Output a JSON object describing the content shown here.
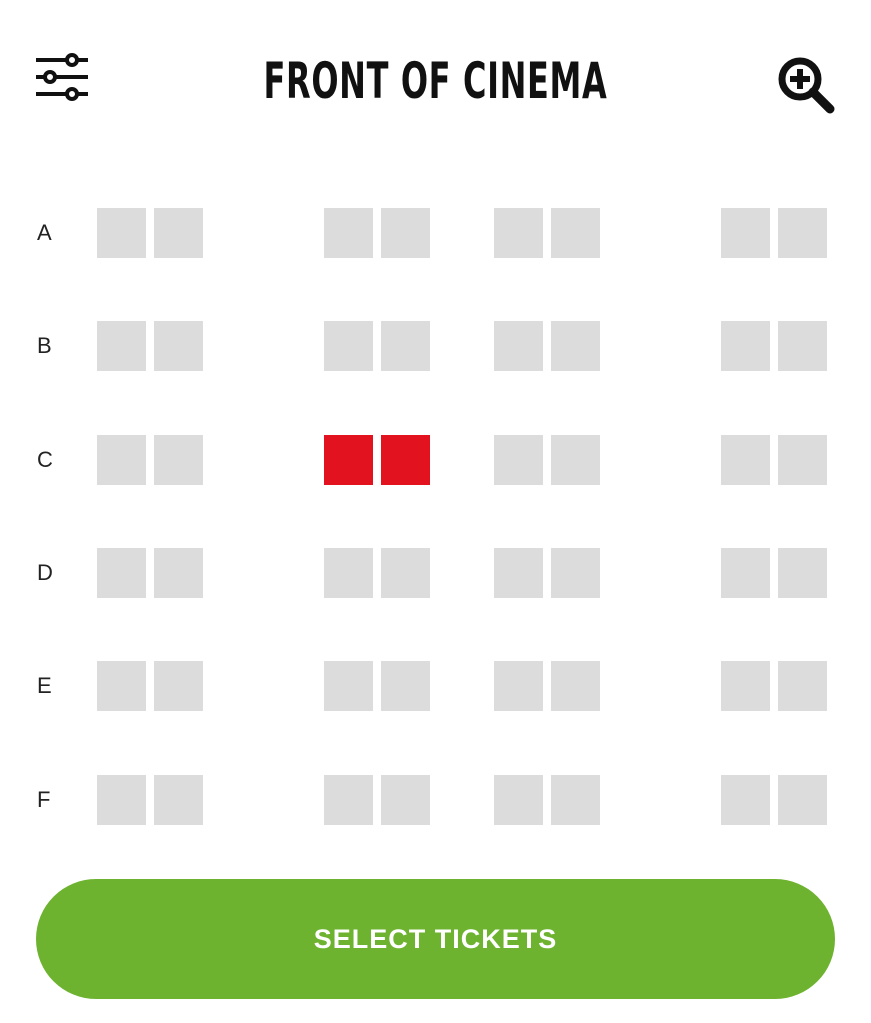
{
  "header": {
    "title": "FRONT OF CINEMA",
    "left_icon": "filter-sliders-icon",
    "right_icon": "zoom-in-icon"
  },
  "seat_map": {
    "rows": [
      {
        "label": "A",
        "seats": [
          "available",
          "available",
          "available",
          "available",
          "available",
          "available",
          "available",
          "available"
        ]
      },
      {
        "label": "B",
        "seats": [
          "available",
          "available",
          "available",
          "available",
          "available",
          "available",
          "available",
          "available"
        ]
      },
      {
        "label": "C",
        "seats": [
          "available",
          "available",
          "selected",
          "selected",
          "available",
          "available",
          "available",
          "available"
        ]
      },
      {
        "label": "D",
        "seats": [
          "available",
          "available",
          "available",
          "available",
          "available",
          "available",
          "available",
          "available"
        ]
      },
      {
        "label": "E",
        "seats": [
          "available",
          "available",
          "available",
          "available",
          "available",
          "available",
          "available",
          "available"
        ]
      },
      {
        "label": "F",
        "seats": [
          "available",
          "available",
          "available",
          "available",
          "available",
          "available",
          "available",
          "available"
        ]
      }
    ],
    "colors": {
      "available": "#dcdcdc",
      "selected": "#e2121f"
    }
  },
  "cta": {
    "label": "SELECT TICKETS",
    "color": "#6db32f"
  }
}
